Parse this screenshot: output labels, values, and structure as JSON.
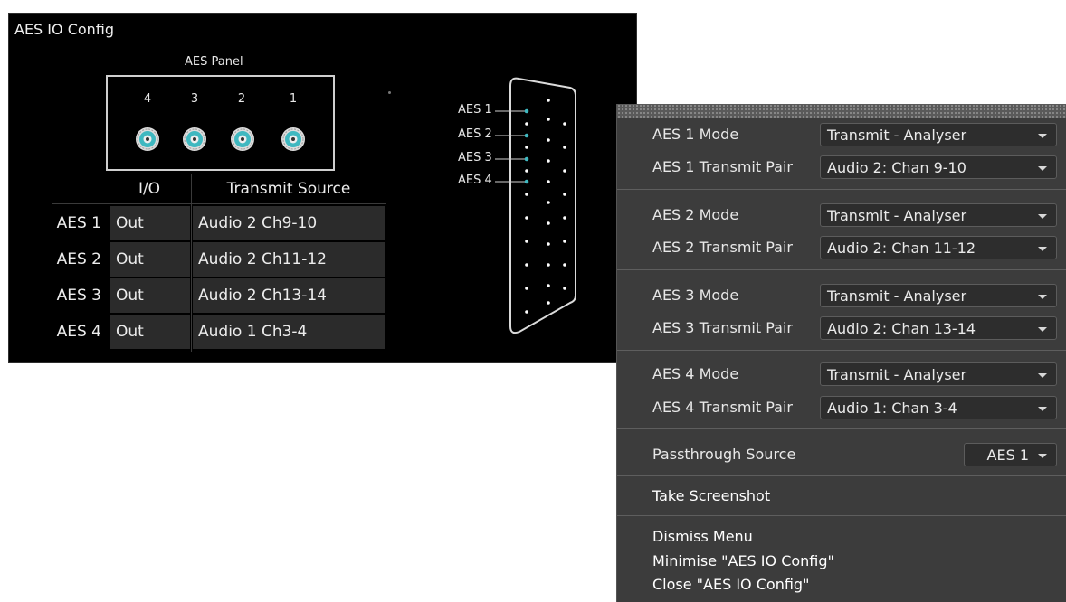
{
  "window": {
    "title": "AES IO Config",
    "panel_title": "AES Panel",
    "panel_numbers": [
      "4",
      "3",
      "2",
      "1"
    ],
    "table": {
      "headers": [
        "I/O",
        "Transmit Source"
      ],
      "rows": [
        {
          "label": "AES 1",
          "io": "Out",
          "source": "Audio 2 Ch9-10"
        },
        {
          "label": "AES 2",
          "io": "Out",
          "source": "Audio 2 Ch11-12"
        },
        {
          "label": "AES 3",
          "io": "Out",
          "source": "Audio 2 Ch13-14"
        },
        {
          "label": "AES 4",
          "io": "Out",
          "source": "Audio 1 Ch3-4"
        }
      ]
    },
    "connector_labels": [
      "AES 1",
      "AES 2",
      "AES 3",
      "AES 4"
    ]
  },
  "menu": {
    "groups": [
      {
        "mode_label": "AES 1 Mode",
        "mode_value": "Transmit - Analyser",
        "pair_label": "AES 1 Transmit Pair",
        "pair_value": "Audio 2: Chan 9-10"
      },
      {
        "mode_label": "AES 2 Mode",
        "mode_value": "Transmit - Analyser",
        "pair_label": "AES 2 Transmit Pair",
        "pair_value": "Audio 2: Chan 11-12"
      },
      {
        "mode_label": "AES 3 Mode",
        "mode_value": "Transmit - Analyser",
        "pair_label": "AES 3 Transmit Pair",
        "pair_value": "Audio 2: Chan 13-14"
      },
      {
        "mode_label": "AES 4 Mode",
        "mode_value": "Transmit - Analyser",
        "pair_label": "AES 4 Transmit Pair",
        "pair_value": "Audio 1: Chan 3-4"
      }
    ],
    "passthrough_label": "Passthrough Source",
    "passthrough_value": "AES 1",
    "take_screenshot": "Take Screenshot",
    "dismiss": "Dismiss Menu",
    "minimise": "Minimise \"AES IO Config\"",
    "close": "Close \"AES IO Config\""
  },
  "colors": {
    "window_bg": "#000000",
    "cell_bg": "#2b2b2b",
    "menu_bg": "#3c3c3c",
    "bnc_accent": "#3fb8c0",
    "connector_pin": "#3fb8c0"
  }
}
